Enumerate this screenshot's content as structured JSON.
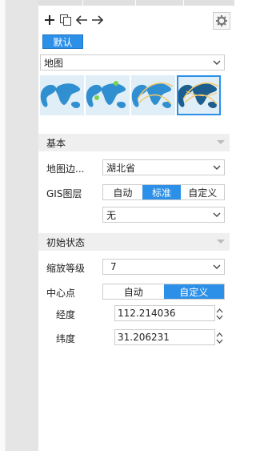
{
  "toolbar": {
    "add_icon": "plus-icon",
    "copy_icon": "copy-icon",
    "back_icon": "arrow-left-icon",
    "forward_icon": "arrow-right-icon",
    "settings_icon": "gear-icon"
  },
  "tabs": [
    {
      "label": "默认",
      "active": true
    }
  ],
  "map_type": {
    "value": "地图"
  },
  "thumbnails": [
    {
      "style": "plain",
      "selected": false
    },
    {
      "style": "point",
      "selected": false
    },
    {
      "style": "flow",
      "selected": false
    },
    {
      "style": "flow-dark",
      "selected": true
    }
  ],
  "basic_section": {
    "title": "基本",
    "map_boundary": {
      "label": "地图边...",
      "value": "湖北省"
    },
    "gis_layer": {
      "label": "GIS图层",
      "options": [
        "自动",
        "标准",
        "自定义"
      ],
      "selected": "标准",
      "sub_select": "无"
    }
  },
  "initial_section": {
    "title": "初始状态",
    "zoom_level": {
      "label": "缩放等级",
      "value": "7"
    },
    "center": {
      "label": "中心点",
      "options": [
        "自动",
        "自定义"
      ],
      "selected": "自定义",
      "longitude": {
        "label": "经度",
        "value": "112.214036"
      },
      "latitude": {
        "label": "纬度",
        "value": "31.206231"
      }
    }
  },
  "colors": {
    "accent": "#2d90e8",
    "section_bg": "#efefef",
    "gutter": "#e5e5e5"
  }
}
